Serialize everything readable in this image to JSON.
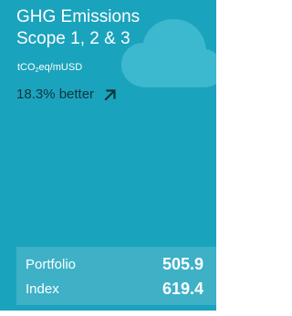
{
  "card": {
    "title_line1": "GHG Emissions",
    "title_line2": "Scope 1, 2 & 3",
    "units_prefix": "tCO",
    "units_subscript": "2",
    "units_suffix": "eq/mUSD",
    "trend_text": "18.3% better",
    "trend_icon": "arrow-up-right-icon",
    "background_icon": "cloud-icon",
    "colors": {
      "background": "#1aa3bd",
      "text": "#ffffff",
      "trend_text": "#10353e",
      "icon_tint": "#3cb8cf"
    }
  },
  "summary": {
    "portfolio_label": "Portfolio",
    "portfolio_value": "505.9",
    "index_label": "Index",
    "index_value": "619.4"
  }
}
